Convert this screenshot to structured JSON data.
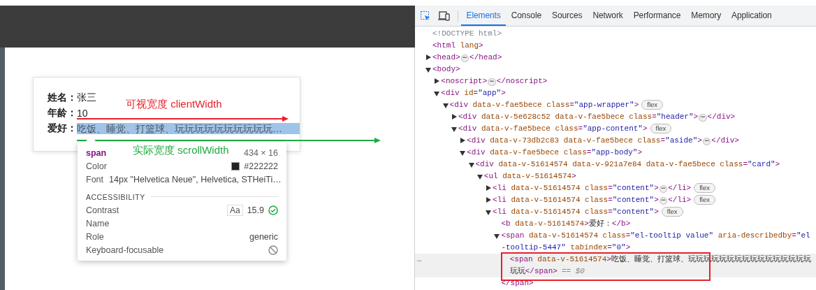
{
  "page": {
    "rows": [
      {
        "label": "姓名：",
        "value": "张三",
        "kind": "plain"
      },
      {
        "label": "年龄：",
        "value": "10",
        "kind": "plain"
      },
      {
        "label": "爱好：",
        "value": "吃饭、睡觉、打篮球、玩玩玩玩玩玩玩玩玩玩…",
        "kind": "inspected"
      }
    ],
    "annotations": [
      {
        "text": "可视宽度 clientWidth",
        "color": "#e8202a"
      },
      {
        "text": "实际宽度 scrollWidth",
        "color": "#22aa44"
      }
    ],
    "inspect_tooltip": {
      "tag": "span",
      "size": "434 × 16",
      "color_label": "Color",
      "color_value": "#222222",
      "font_label": "Font",
      "font_value": "14px \"Helvetica Neue\", Helvetica, STHeiTi…",
      "section": "ACCESSIBILITY",
      "contrast_label": "Contrast",
      "contrast_sample": "Aa",
      "contrast_value": "15.9",
      "name_label": "Name",
      "role_label": "Role",
      "role_value": "generic",
      "focus_label": "Keyboard-focusable"
    }
  },
  "devtools": {
    "tabs": [
      {
        "label": "Elements",
        "selected": true
      },
      {
        "label": "Console",
        "selected": false
      },
      {
        "label": "Sources",
        "selected": false
      },
      {
        "label": "Network",
        "selected": false
      },
      {
        "label": "Performance",
        "selected": false
      },
      {
        "label": "Memory",
        "selected": false
      },
      {
        "label": "Application",
        "selected": false
      }
    ],
    "tree": [
      {
        "kind": "leaf",
        "selected": false,
        "tokens": [
          {
            "kind": "grey",
            "text": "<!DOCTYPE html>"
          }
        ]
      },
      {
        "kind": "leaf",
        "selected": false,
        "tokens": [
          {
            "kind": "tag",
            "text": "<html "
          },
          {
            "kind": "attr",
            "text": "lang"
          },
          {
            "kind": "tag",
            "text": ">"
          }
        ]
      },
      {
        "kind": "element",
        "expanded": false,
        "selected": false,
        "tokens": [
          {
            "kind": "tag",
            "text": "<head>"
          },
          {
            "kind": "dots",
            "text": "⋯"
          },
          {
            "kind": "tag",
            "text": "</head>"
          }
        ]
      },
      {
        "kind": "element",
        "expanded": true,
        "selected": false,
        "tokens": [
          {
            "kind": "tag",
            "text": "<body>"
          }
        ],
        "children": [
          {
            "kind": "element",
            "expanded": false,
            "selected": false,
            "tokens": [
              {
                "kind": "tag",
                "text": "<noscript>"
              },
              {
                "kind": "dots",
                "text": "⋯"
              },
              {
                "kind": "tag",
                "text": "</noscript>"
              }
            ]
          },
          {
            "kind": "element",
            "expanded": true,
            "selected": false,
            "tokens": [
              {
                "kind": "tag",
                "text": "<div "
              },
              {
                "kind": "attr",
                "text": "id"
              },
              {
                "kind": "tag",
                "text": "="
              },
              {
                "kind": "value",
                "text": "\"app\""
              },
              {
                "kind": "tag",
                "text": ">"
              }
            ],
            "children": [
              {
                "kind": "element",
                "expanded": true,
                "selected": false,
                "tokens": [
                  {
                    "kind": "tag",
                    "text": "<div "
                  },
                  {
                    "kind": "attr",
                    "text": "data-v-fae5bece class"
                  },
                  {
                    "kind": "tag",
                    "text": "="
                  },
                  {
                    "kind": "value",
                    "text": "\"app-wrapper\""
                  },
                  {
                    "kind": "tag",
                    "text": ">"
                  },
                  {
                    "kind": "badge",
                    "text": "flex"
                  }
                ],
                "children": [
                  {
                    "kind": "element",
                    "expanded": false,
                    "selected": false,
                    "tokens": [
                      {
                        "kind": "tag",
                        "text": "<div "
                      },
                      {
                        "kind": "attr",
                        "text": "data-v-5e628c52 data-v-fae5bece class"
                      },
                      {
                        "kind": "tag",
                        "text": "="
                      },
                      {
                        "kind": "value",
                        "text": "\"header\""
                      },
                      {
                        "kind": "tag",
                        "text": ">"
                      },
                      {
                        "kind": "dots",
                        "text": "⋯"
                      },
                      {
                        "kind": "tag",
                        "text": "</div>"
                      }
                    ]
                  },
                  {
                    "kind": "element",
                    "expanded": true,
                    "selected": false,
                    "tokens": [
                      {
                        "kind": "tag",
                        "text": "<div "
                      },
                      {
                        "kind": "attr",
                        "text": "data-v-fae5bece class"
                      },
                      {
                        "kind": "tag",
                        "text": "="
                      },
                      {
                        "kind": "value",
                        "text": "\"app-content\""
                      },
                      {
                        "kind": "tag",
                        "text": ">"
                      },
                      {
                        "kind": "badge",
                        "text": "flex"
                      }
                    ],
                    "children": [
                      {
                        "kind": "element",
                        "expanded": false,
                        "selected": false,
                        "tokens": [
                          {
                            "kind": "tag",
                            "text": "<div "
                          },
                          {
                            "kind": "attr",
                            "text": "data-v-73db2c83 data-v-fae5bece class"
                          },
                          {
                            "kind": "tag",
                            "text": "="
                          },
                          {
                            "kind": "value",
                            "text": "\"aside\""
                          },
                          {
                            "kind": "tag",
                            "text": ">"
                          },
                          {
                            "kind": "dots",
                            "text": "⋯"
                          },
                          {
                            "kind": "tag",
                            "text": "</div>"
                          }
                        ]
                      },
                      {
                        "kind": "element",
                        "expanded": true,
                        "selected": false,
                        "tokens": [
                          {
                            "kind": "tag",
                            "text": "<div "
                          },
                          {
                            "kind": "attr",
                            "text": "data-v-fae5bece class"
                          },
                          {
                            "kind": "tag",
                            "text": "="
                          },
                          {
                            "kind": "value",
                            "text": "\"app-body\""
                          },
                          {
                            "kind": "tag",
                            "text": ">"
                          }
                        ],
                        "children": [
                          {
                            "kind": "element",
                            "expanded": true,
                            "selected": false,
                            "tokens": [
                              {
                                "kind": "tag",
                                "text": "<div "
                              },
                              {
                                "kind": "attr",
                                "text": "data-v-51614574 data-v-921a7e84 data-v-fae5bece class"
                              },
                              {
                                "kind": "tag",
                                "text": "="
                              },
                              {
                                "kind": "value",
                                "text": "\"card\""
                              },
                              {
                                "kind": "tag",
                                "text": ">"
                              }
                            ],
                            "children": [
                              {
                                "kind": "element",
                                "expanded": true,
                                "selected": false,
                                "tokens": [
                                  {
                                    "kind": "tag",
                                    "text": "<ul "
                                  },
                                  {
                                    "kind": "attr",
                                    "text": "data-v-51614574"
                                  },
                                  {
                                    "kind": "tag",
                                    "text": ">"
                                  }
                                ],
                                "children": [
                                  {
                                    "kind": "element",
                                    "expanded": false,
                                    "selected": false,
                                    "tokens": [
                                      {
                                        "kind": "tag",
                                        "text": "<li "
                                      },
                                      {
                                        "kind": "attr",
                                        "text": "data-v-51614574 class"
                                      },
                                      {
                                        "kind": "tag",
                                        "text": "="
                                      },
                                      {
                                        "kind": "value",
                                        "text": "\"content\""
                                      },
                                      {
                                        "kind": "tag",
                                        "text": ">"
                                      },
                                      {
                                        "kind": "dots",
                                        "text": "⋯"
                                      },
                                      {
                                        "kind": "tag",
                                        "text": "</li>"
                                      },
                                      {
                                        "kind": "badge",
                                        "text": "flex"
                                      }
                                    ]
                                  },
                                  {
                                    "kind": "element",
                                    "expanded": false,
                                    "selected": false,
                                    "tokens": [
                                      {
                                        "kind": "tag",
                                        "text": "<li "
                                      },
                                      {
                                        "kind": "attr",
                                        "text": "data-v-51614574 class"
                                      },
                                      {
                                        "kind": "tag",
                                        "text": "="
                                      },
                                      {
                                        "kind": "value",
                                        "text": "\"content\""
                                      },
                                      {
                                        "kind": "tag",
                                        "text": ">"
                                      },
                                      {
                                        "kind": "dots",
                                        "text": "⋯"
                                      },
                                      {
                                        "kind": "tag",
                                        "text": "</li>"
                                      },
                                      {
                                        "kind": "badge",
                                        "text": "flex"
                                      }
                                    ]
                                  },
                                  {
                                    "kind": "element",
                                    "expanded": true,
                                    "selected": false,
                                    "tokens": [
                                      {
                                        "kind": "tag",
                                        "text": "<li "
                                      },
                                      {
                                        "kind": "attr",
                                        "text": "data-v-51614574 class"
                                      },
                                      {
                                        "kind": "tag",
                                        "text": "="
                                      },
                                      {
                                        "kind": "value",
                                        "text": "\"content\""
                                      },
                                      {
                                        "kind": "tag",
                                        "text": ">"
                                      },
                                      {
                                        "kind": "badge",
                                        "text": "flex"
                                      }
                                    ],
                                    "children": [
                                      {
                                        "kind": "leaf",
                                        "selected": false,
                                        "tokens": [
                                          {
                                            "kind": "tag",
                                            "text": "<b "
                                          },
                                          {
                                            "kind": "attr",
                                            "text": "data-v-51614574"
                                          },
                                          {
                                            "kind": "tag",
                                            "text": ">"
                                          },
                                          {
                                            "kind": "text",
                                            "text": "爱好："
                                          },
                                          {
                                            "kind": "tag",
                                            "text": "</b>"
                                          }
                                        ]
                                      },
                                      {
                                        "kind": "element",
                                        "expanded": true,
                                        "selected": false,
                                        "tokens": [
                                          {
                                            "kind": "tag",
                                            "text": "<span "
                                          },
                                          {
                                            "kind": "attr",
                                            "text": "data-v-51614574 class"
                                          },
                                          {
                                            "kind": "tag",
                                            "text": "="
                                          },
                                          {
                                            "kind": "value",
                                            "text": "\"el-tooltip value\" "
                                          },
                                          {
                                            "kind": "attr",
                                            "text": "aria-describedby"
                                          },
                                          {
                                            "kind": "tag",
                                            "text": "="
                                          },
                                          {
                                            "kind": "value",
                                            "text": "\"el-tooltip-5447\" "
                                          },
                                          {
                                            "kind": "attr",
                                            "text": "tabindex"
                                          },
                                          {
                                            "kind": "tag",
                                            "text": "="
                                          },
                                          {
                                            "kind": "value",
                                            "text": "\"0\""
                                          },
                                          {
                                            "kind": "tag",
                                            "text": ">"
                                          }
                                        ],
                                        "children": [
                                          {
                                            "kind": "leaf",
                                            "selected": true,
                                            "menu": "…",
                                            "tokens": [
                                              {
                                                "kind": "tag",
                                                "text": "<span "
                                              },
                                              {
                                                "kind": "attr",
                                                "text": "data-v-51614574"
                                              },
                                              {
                                                "kind": "tag",
                                                "text": ">"
                                              },
                                              {
                                                "kind": "text",
                                                "text": "吃饭、睡觉、打篮球、玩玩玩玩玩玩玩玩玩玩玩玩玩玩玩玩玩玩"
                                              },
                                              {
                                                "kind": "tag",
                                                "text": "</span>"
                                              },
                                              {
                                                "kind": "ref",
                                                "text": "== $0"
                                              }
                                            ]
                                          }
                                        ]
                                      },
                                      {
                                        "kind": "leaf",
                                        "selected": false,
                                        "tokens": [
                                          {
                                            "kind": "tag",
                                            "text": "</span>"
                                          }
                                        ]
                                      }
                                    ]
                                  }
                                ]
                              }
                            ]
                          }
                        ]
                      }
                    ]
                  }
                ]
              }
            ]
          }
        ]
      }
    ]
  }
}
